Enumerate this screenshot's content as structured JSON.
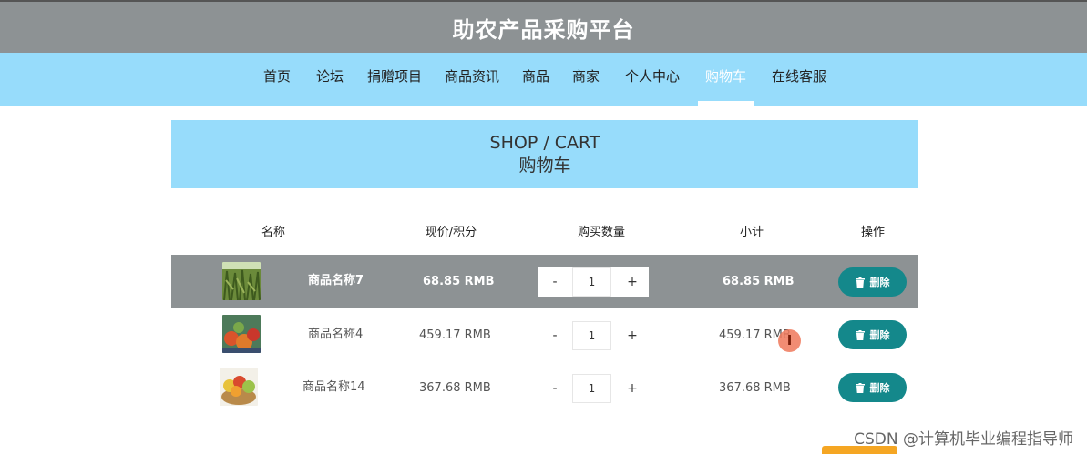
{
  "header": {
    "title": "助农产品采购平台"
  },
  "nav": {
    "items": [
      "首页",
      "论坛",
      "捐赠项目",
      "商品资讯",
      "商品",
      "商家",
      "个人中心",
      "购物车",
      "在线客服"
    ],
    "active": "购物车"
  },
  "banner": {
    "en": "SHOP / CART",
    "cn": "购物车"
  },
  "table": {
    "headers": {
      "name": "名称",
      "price": "现价/积分",
      "qty": "购买数量",
      "subtotal": "小计",
      "action": "操作"
    },
    "rows": [
      {
        "name": "商品名称7",
        "price": "68.85 RMB",
        "qty": "1",
        "subtotal": "68.85 RMB",
        "minus": "-",
        "plus": "+",
        "delete": "删除",
        "image": "green-crop-photo"
      },
      {
        "name": "商品名称4",
        "price": "459.17 RMB",
        "qty": "1",
        "subtotal": "459.17 RMB",
        "minus": "-",
        "plus": "+",
        "delete": "删除",
        "image": "vegetables-photo"
      },
      {
        "name": "商品名称14",
        "price": "367.68 RMB",
        "qty": "1",
        "subtotal": "367.68 RMB",
        "minus": "-",
        "plus": "+",
        "delete": "删除",
        "image": "fruit-basket-photo"
      }
    ]
  },
  "watermark": "CSDN @计算机毕业编程指导师",
  "colors": {
    "header_bg": "#8d9294",
    "nav_bg": "#97dcfb",
    "button_bg": "#14888b",
    "selected_row": "#8d9294"
  },
  "icons": {
    "delete": "trash-icon",
    "cursor": "text-cursor-icon"
  }
}
